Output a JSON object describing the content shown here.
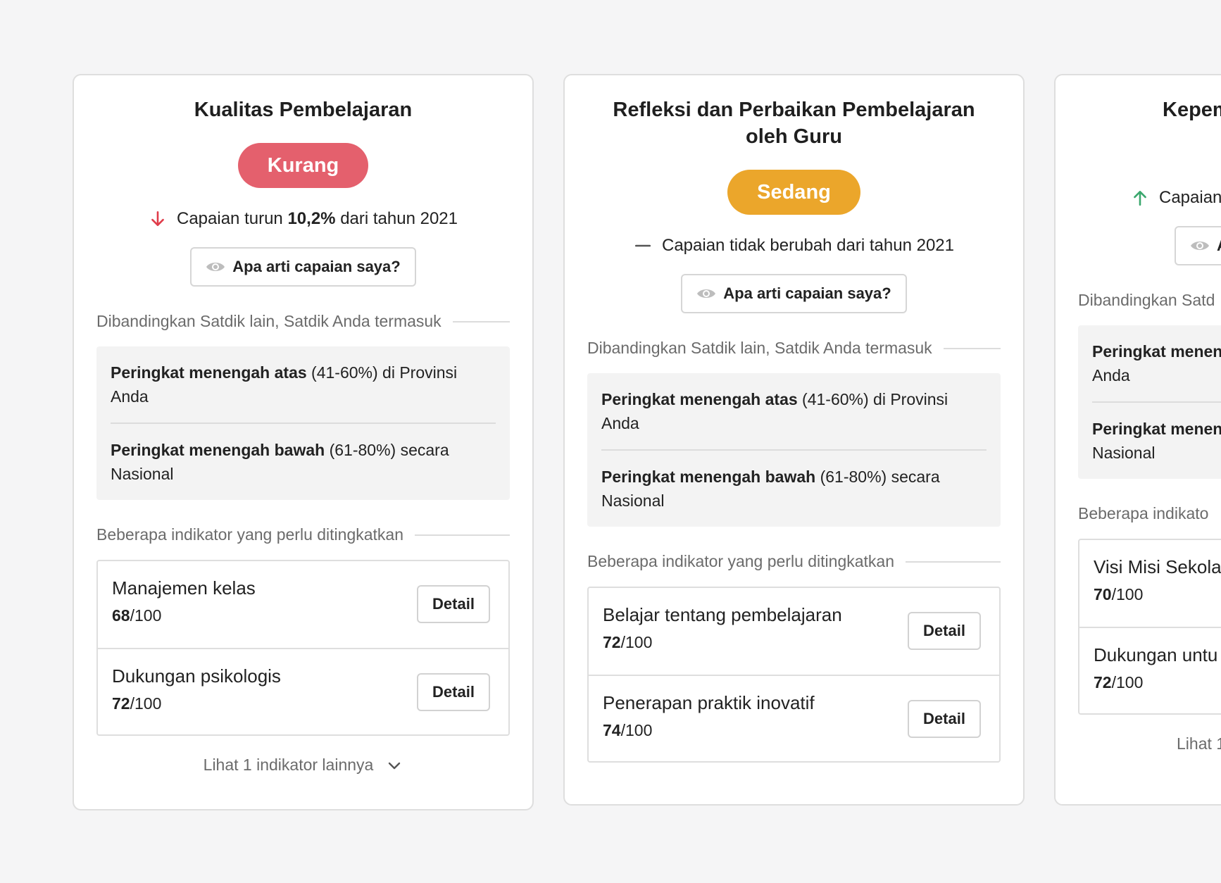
{
  "cards": [
    {
      "title": "Kualitas Pembelajaran",
      "badge": "Kurang",
      "trend_prefix": "Capaian turun",
      "trend_value": "10,2%",
      "trend_suffix": "dari tahun 2021",
      "trend_icon": "arrow-down-icon",
      "meaning_button": "Apa arti capaian saya?",
      "compare_heading": "Dibandingkan Satdik lain, Satdik Anda termasuk",
      "ranks": [
        {
          "bold": "Peringkat menengah atas",
          "rest": " (41-60%) di Provinsi Anda"
        },
        {
          "bold": "Peringkat menengah bawah",
          "rest": " (61-80%) secara Nasional"
        }
      ],
      "indicator_heading": "Beberapa indikator yang perlu ditingkatkan",
      "indicators": [
        {
          "name": "Manajemen kelas",
          "score": "68",
          "max": "/100",
          "button": "Detail"
        },
        {
          "name": "Dukungan psikologis",
          "score": "72",
          "max": "/100",
          "button": "Detail"
        }
      ],
      "more_label": "Lihat 1 indikator lainnya"
    },
    {
      "title": "Refleksi dan Perbaikan Pembelajaran oleh Guru",
      "badge": "Sedang",
      "trend_prefix": "Capaian tidak berubah dari tahun 2021",
      "trend_icon": "dash-icon",
      "meaning_button": "Apa arti capaian saya?",
      "compare_heading": "Dibandingkan Satdik lain, Satdik Anda termasuk",
      "ranks": [
        {
          "bold": "Peringkat menengah atas",
          "rest": " (41-60%) di Provinsi Anda"
        },
        {
          "bold": "Peringkat menengah bawah",
          "rest": " (61-80%) secara Nasional"
        }
      ],
      "indicator_heading": "Beberapa indikator yang perlu ditingkatkan",
      "indicators": [
        {
          "name": "Belajar tentang pembelajaran",
          "score": "72",
          "max": "/100",
          "button": "Detail"
        },
        {
          "name": "Penerapan praktik inovatif",
          "score": "74",
          "max": "/100",
          "button": "Detail"
        }
      ]
    },
    {
      "title": "Kepemi",
      "trend_prefix": "Capaian",
      "trend_icon": "arrow-up-icon",
      "meaning_button": "A",
      "compare_heading": "Dibandingkan Satd",
      "ranks": [
        {
          "bold": "Peringkat menen",
          "rest": " Anda"
        },
        {
          "bold": "Peringkat menen",
          "rest": " Nasional"
        }
      ],
      "indicator_heading": "Beberapa indikato",
      "indicators": [
        {
          "name": "Visi Misi Sekola",
          "score": "70",
          "max": "/100"
        },
        {
          "name": "Dukungan untu",
          "score": "72",
          "max": "/100"
        }
      ],
      "more_label": "Lihat 1"
    }
  ],
  "colors": {
    "kurang": "#e4606d",
    "sedang": "#eba62b",
    "down_arrow": "#e03c4a",
    "up_arrow": "#3aa76d"
  }
}
